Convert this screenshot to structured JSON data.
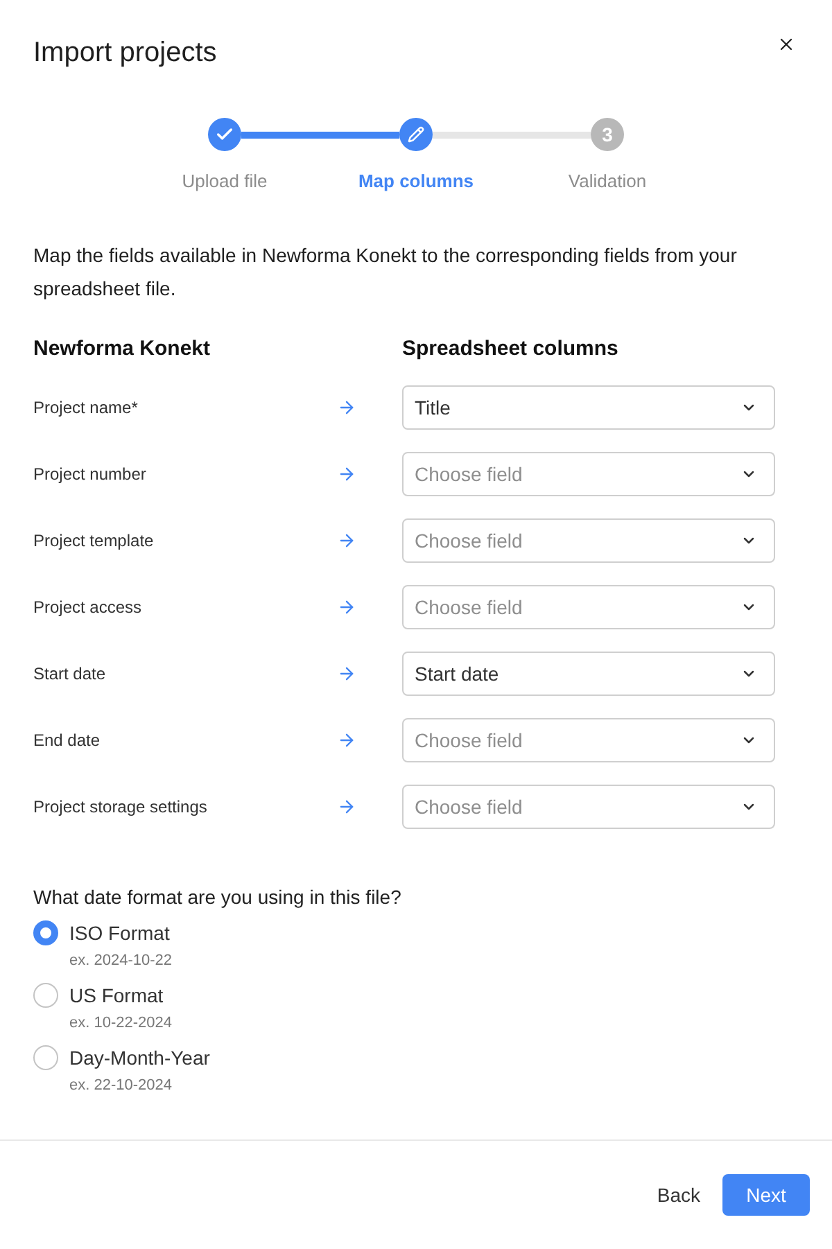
{
  "dialog": {
    "title": "Import projects"
  },
  "steps": [
    {
      "label": "Upload file",
      "completed": true,
      "selected": false
    },
    {
      "label": "Map columns",
      "completed": false,
      "selected": true
    },
    {
      "label": "Validation",
      "completed": false,
      "selected": false,
      "number": "3"
    }
  ],
  "description": "Map the fields available in Newforma Konekt to the corresponding fields from your spreadsheet file.",
  "columns": {
    "source": "Newforma Konekt",
    "target": "Spreadsheet columns"
  },
  "mappings": [
    {
      "field": "Project name*",
      "value": "Title"
    },
    {
      "field": "Project number",
      "placeholder": "Choose field"
    },
    {
      "field": "Project template",
      "placeholder": "Choose field"
    },
    {
      "field": "Project access",
      "placeholder": "Choose field"
    },
    {
      "field": "Start date",
      "value": "Start date"
    },
    {
      "field": "End date",
      "placeholder": "Choose field"
    },
    {
      "field": "Project storage settings",
      "placeholder": "Choose field"
    }
  ],
  "date_format": {
    "question": "What date format are you using in this file?",
    "options": [
      {
        "label": "ISO Format",
        "example": "ex. 2024-10-22",
        "selected": true
      },
      {
        "label": "US Format",
        "example": "ex. 10-22-2024",
        "selected": false
      },
      {
        "label": "Day-Month-Year",
        "example": "ex. 22-10-2024",
        "selected": false
      }
    ]
  },
  "buttons": [
    {
      "label": "Back",
      "kind": "text"
    },
    {
      "label": "Next",
      "kind": "primary"
    }
  ]
}
